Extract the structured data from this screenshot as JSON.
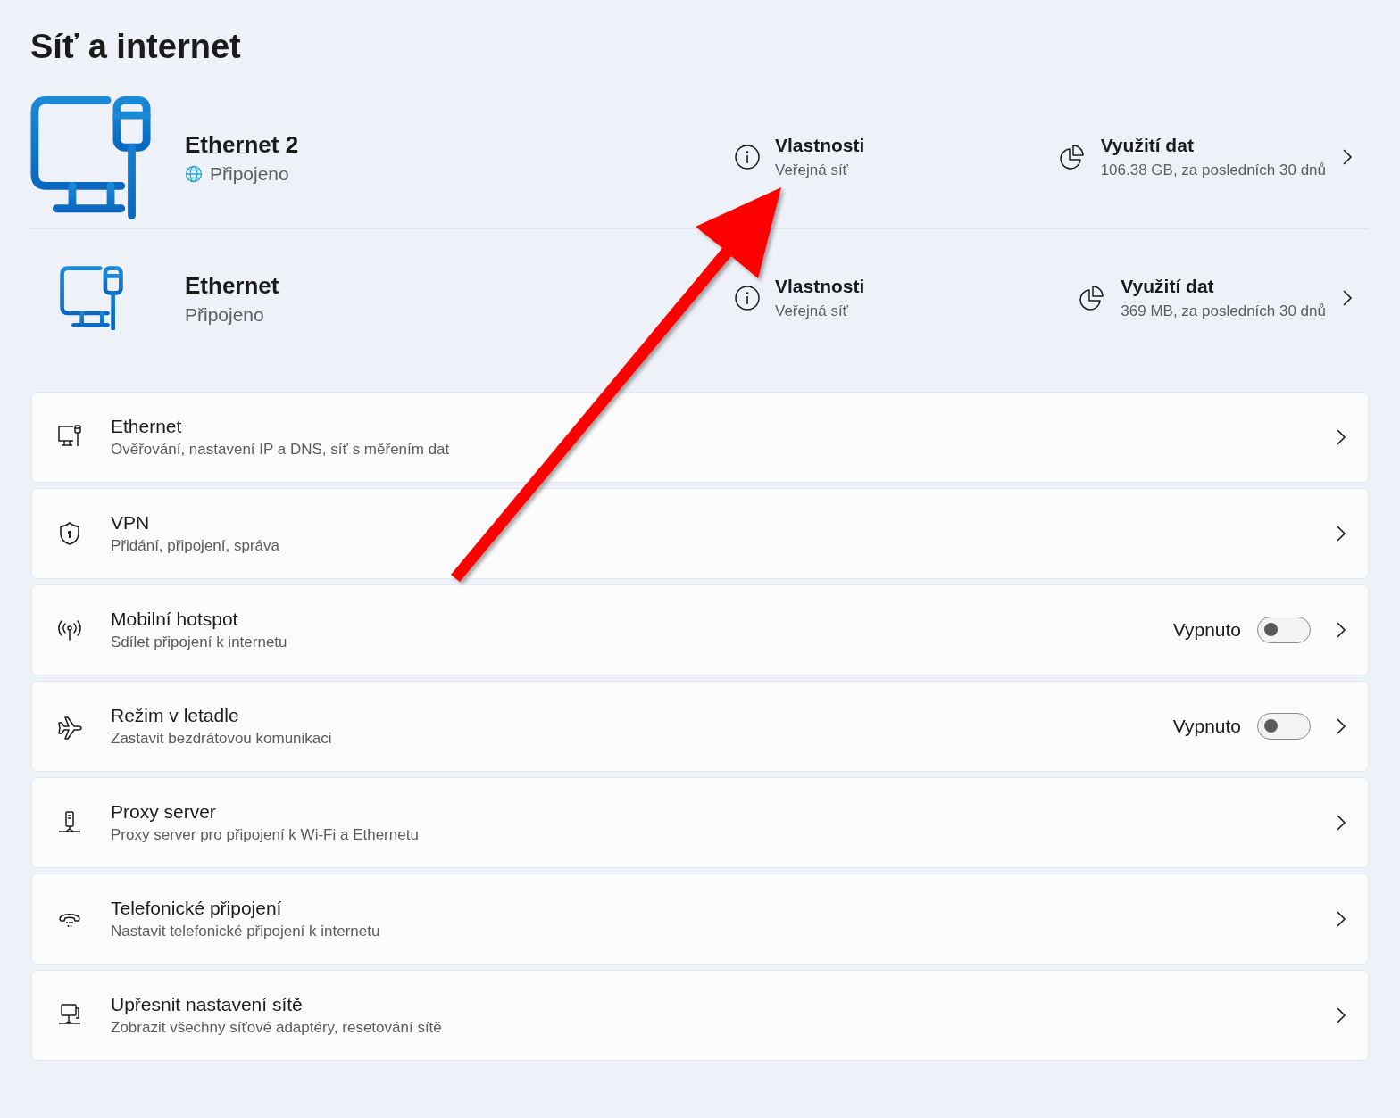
{
  "title": "Síť a internet",
  "adapters": [
    {
      "kind": "large",
      "name": "Ethernet 2",
      "status": "Připojeno",
      "internet_access": true,
      "properties_label": "Vlastnosti",
      "network_type": "Veřejná síť",
      "usage_label": "Využití dat",
      "usage": "106.38 GB, za posledních 30 dnů"
    },
    {
      "kind": "small",
      "name": "Ethernet",
      "status": "Připojeno",
      "internet_access": false,
      "properties_label": "Vlastnosti",
      "network_type": "Veřejná síť",
      "usage_label": "Využití dat",
      "usage": "369 MB, za posledních 30 dnů"
    }
  ],
  "settings": [
    {
      "kind": "link",
      "title": "Ethernet",
      "description": "Ověřování, nastavení IP a DNS, síť s měřením dat"
    },
    {
      "kind": "link",
      "title": "VPN",
      "description": "Přidání, připojení, správa"
    },
    {
      "kind": "toggle",
      "title": "Mobilní hotspot",
      "description": "Sdílet připojení k internetu",
      "state_label": "Vypnuto",
      "on": false
    },
    {
      "kind": "toggle",
      "title": "Režim v letadle",
      "description": "Zastavit bezdrátovou komunikaci",
      "state_label": "Vypnuto",
      "on": false
    },
    {
      "kind": "link",
      "title": "Proxy server",
      "description": "Proxy server pro připojení k Wi-Fi a Ethernetu"
    },
    {
      "kind": "link",
      "title": "Telefonické připojení",
      "description": "Nastavit telefonické připojení k internetu"
    },
    {
      "kind": "link",
      "title": "Upřesnit nastavení sítě",
      "description": "Zobrazit všechny síťové adaptéry, resetování sítě"
    }
  ]
}
